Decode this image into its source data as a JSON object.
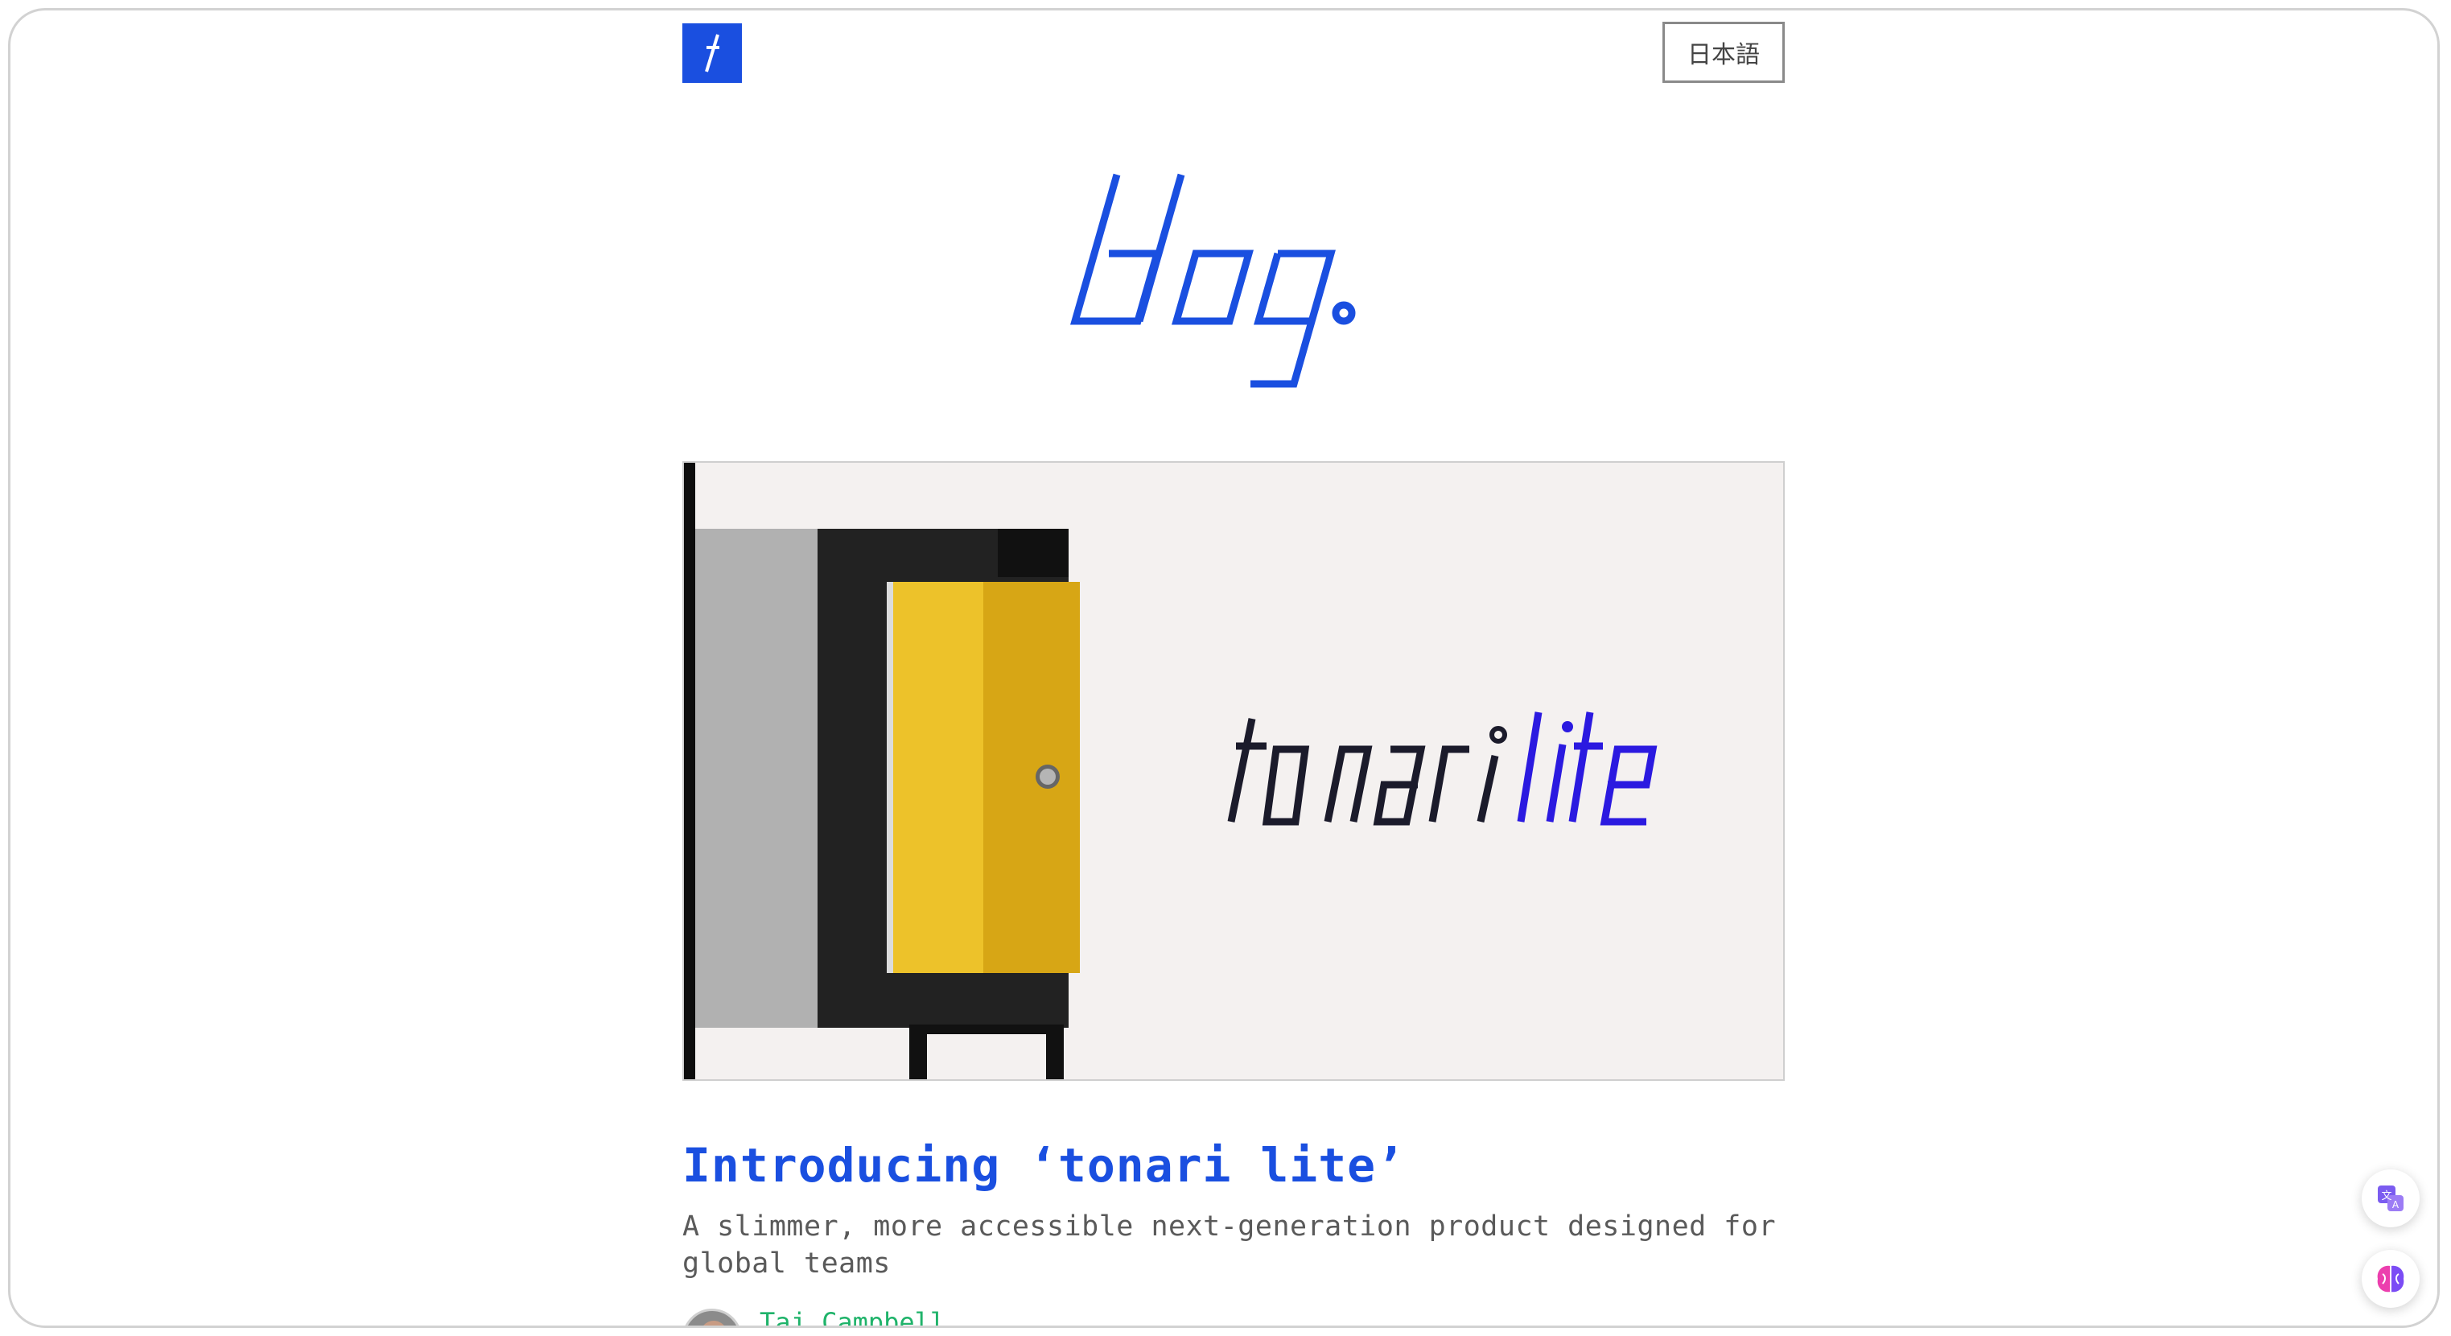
{
  "header": {
    "logo_name": "tonari-logo",
    "language_button_label": "日本語"
  },
  "blog_wordmark": "blog.",
  "hero": {
    "wordmark_dark": "tonari",
    "wordmark_accent": "lite"
  },
  "post": {
    "title": "Introducing ‘tonari lite’",
    "subtitle": "A slimmer, more accessible next-generation product designed for global teams",
    "author": "Taj Campbell"
  },
  "floating_buttons": [
    "translate-icon",
    "brain-icon"
  ],
  "colors": {
    "accent_blue": "#1a4fe0",
    "lite_purple": "#2b1ae0",
    "author_green": "#1fb36a",
    "door_yellow": "#e6b51c"
  }
}
